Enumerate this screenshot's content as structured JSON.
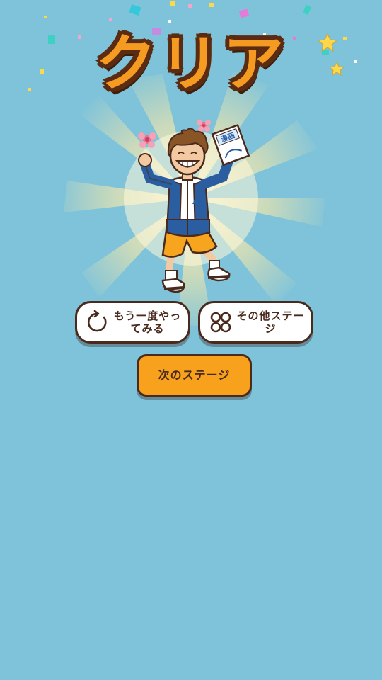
{
  "clear_screen": {
    "title": "クリア",
    "retry_button": {
      "label": "もう一度やってみる",
      "icon": "retry-icon"
    },
    "other_stages_button": {
      "label": "その他ステージ",
      "icon": "grid-icon"
    },
    "next_stage_button": {
      "label": "次のステージ"
    },
    "character": {
      "book_label": "漫画"
    }
  },
  "colors": {
    "background": "#7ec3da",
    "title_fill": "#f59b21",
    "title_outline": "#5b2b12",
    "button_border": "#4a2a1d",
    "next_button": "#f8a11d"
  }
}
